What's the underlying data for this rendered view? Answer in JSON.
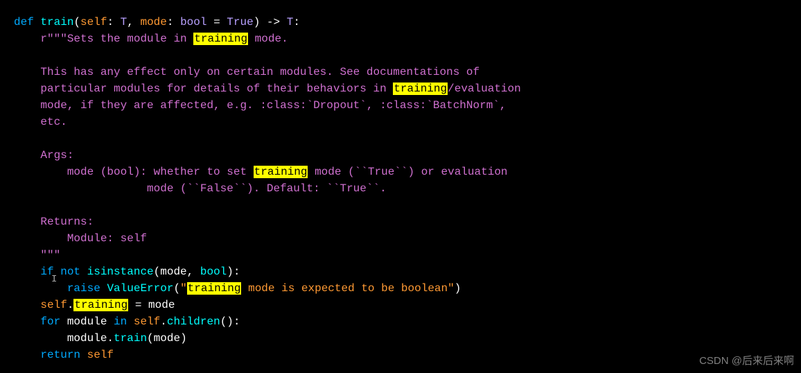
{
  "code": {
    "line1": {
      "def": "def",
      "fn": "train",
      "p1": "(",
      "self": "self",
      "colon1": ": ",
      "t1": "T",
      "comma": ", ",
      "mode": "mode",
      "colon2": ": ",
      "bool": "bool",
      "eq": " = ",
      "true": "True",
      "p2": ") -> ",
      "t2": "T",
      "end": ":"
    },
    "line2": {
      "indent": "    ",
      "r": "r",
      "q": "\"\"\"",
      "t1": "Sets the module in ",
      "hl": "training",
      "t2": " mode."
    },
    "line3": "",
    "line4": {
      "indent": "    ",
      "t": "This has any effect only on certain modules. See documentations of"
    },
    "line5": {
      "indent": "    ",
      "t1": "particular modules for details of their behaviors in ",
      "hl": "training",
      "t2": "/evaluation"
    },
    "line6": {
      "indent": "    ",
      "t": "mode, if they are affected, e.g. :class:`Dropout`, :class:`BatchNorm`,"
    },
    "line7": {
      "indent": "    ",
      "t": "etc."
    },
    "line8": "",
    "line9": {
      "indent": "    ",
      "t": "Args:"
    },
    "line10": {
      "indent": "        ",
      "t1": "mode (bool): whether to set ",
      "hl": "training",
      "t2": " mode (``True``) or evaluation"
    },
    "line11": {
      "indent": "                    ",
      "t": "mode (``False``). Default: ``True``."
    },
    "line12": "",
    "line13": {
      "indent": "    ",
      "t": "Returns:"
    },
    "line14": {
      "indent": "        ",
      "t": "Module: self"
    },
    "line15": {
      "indent": "    ",
      "q": "\"\"\""
    },
    "line16": {
      "indent": "    ",
      "if": "if",
      "not": " not ",
      "isinst": "isinstance",
      "p1": "(",
      "mode": "mode",
      "comma": ", ",
      "bool": "bool",
      "p2": "):"
    },
    "line17": {
      "indent": "        ",
      "raise": "raise",
      "sp": " ",
      "err": "ValueError",
      "p1": "(",
      "q1": "\"",
      "hl": "training",
      "t": " mode is expected to be boolean",
      "q2": "\"",
      "p2": ")"
    },
    "line18": {
      "indent": "    ",
      "self": "self",
      "dot": ".",
      "hl": "training",
      "eq": " = ",
      "mode": "mode"
    },
    "line19": {
      "indent": "    ",
      "for": "for",
      "sp1": " ",
      "module": "module",
      "sp2": " ",
      "in": "in",
      "sp3": " ",
      "self": "self",
      "dot": ".",
      "children": "children",
      "p": "():"
    },
    "line20": {
      "indent": "        ",
      "module": "module",
      "dot": ".",
      "train": "train",
      "p1": "(",
      "mode": "mode",
      "p2": ")"
    },
    "line21": {
      "indent": "    ",
      "return": "return",
      "sp": " ",
      "self": "self"
    }
  },
  "watermark": "CSDN @后来后来啊",
  "cursor": "I"
}
